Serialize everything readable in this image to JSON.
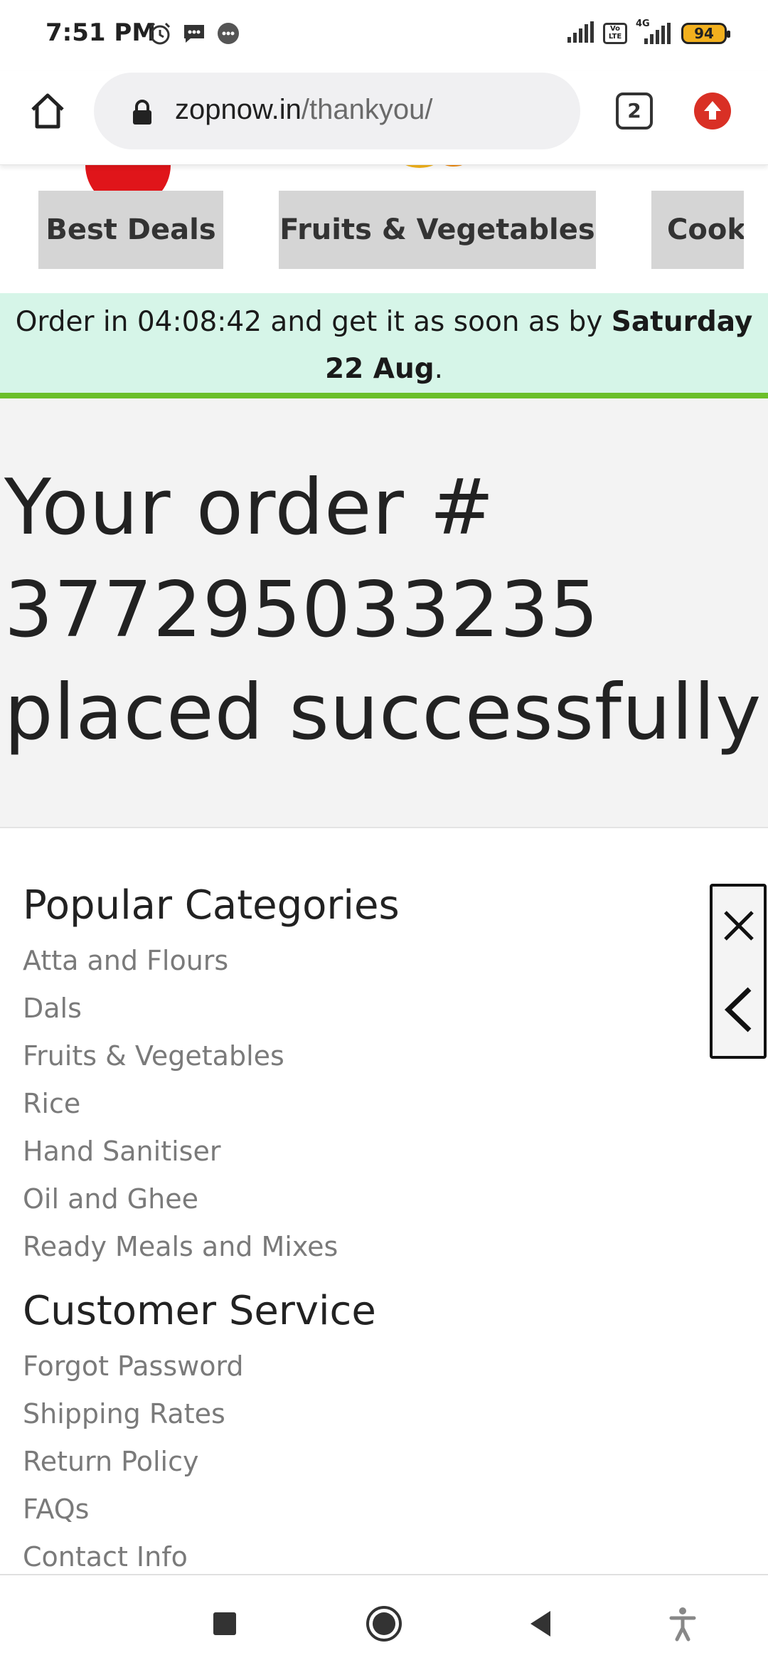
{
  "status_bar": {
    "time": "7:51 PM",
    "network_label": "4G",
    "volte_label": "Vo LTE",
    "battery": "94"
  },
  "browser": {
    "url_domain": "zopnow.in",
    "url_path": "/thankyou/",
    "tab_count": "2"
  },
  "categories": [
    {
      "label": "Best Deals"
    },
    {
      "label": "Fruits & Vegetables"
    },
    {
      "label": "Cook"
    }
  ],
  "delivery_banner": {
    "prefix": "Order in 04:08:42 and get it as soon as by ",
    "date": "Saturday 22 Aug",
    "suffix": "."
  },
  "order": {
    "line1": "Your order #",
    "line2": "377295033235",
    "line3": "placed successfully"
  },
  "footer": {
    "popular_heading": "Popular Categories",
    "popular_links": [
      "Atta and Flours",
      "Dals",
      "Fruits & Vegetables",
      "Rice",
      "Hand Sanitiser",
      "Oil and Ghee",
      "Ready Meals and Mixes"
    ],
    "service_heading": "Customer Service",
    "service_links": [
      "Forgot Password",
      "Shipping Rates",
      "Return Policy",
      "FAQs",
      "Contact Info"
    ]
  },
  "colors": {
    "banner_bg": "#d6f5e8",
    "banner_border": "#6bbf2a",
    "order_bg": "#f3f3f3",
    "link_gray": "#7a7a7a",
    "brand_red": "#e0151a"
  },
  "icons": {
    "home": "home-icon",
    "lock": "lock-icon",
    "update": "update-arrow-icon",
    "close": "close-icon",
    "chevron": "chevron-left-icon",
    "nav_recent": "square-icon",
    "nav_home": "circle-icon",
    "nav_back": "triangle-back-icon",
    "nav_accessibility": "accessibility-icon"
  }
}
